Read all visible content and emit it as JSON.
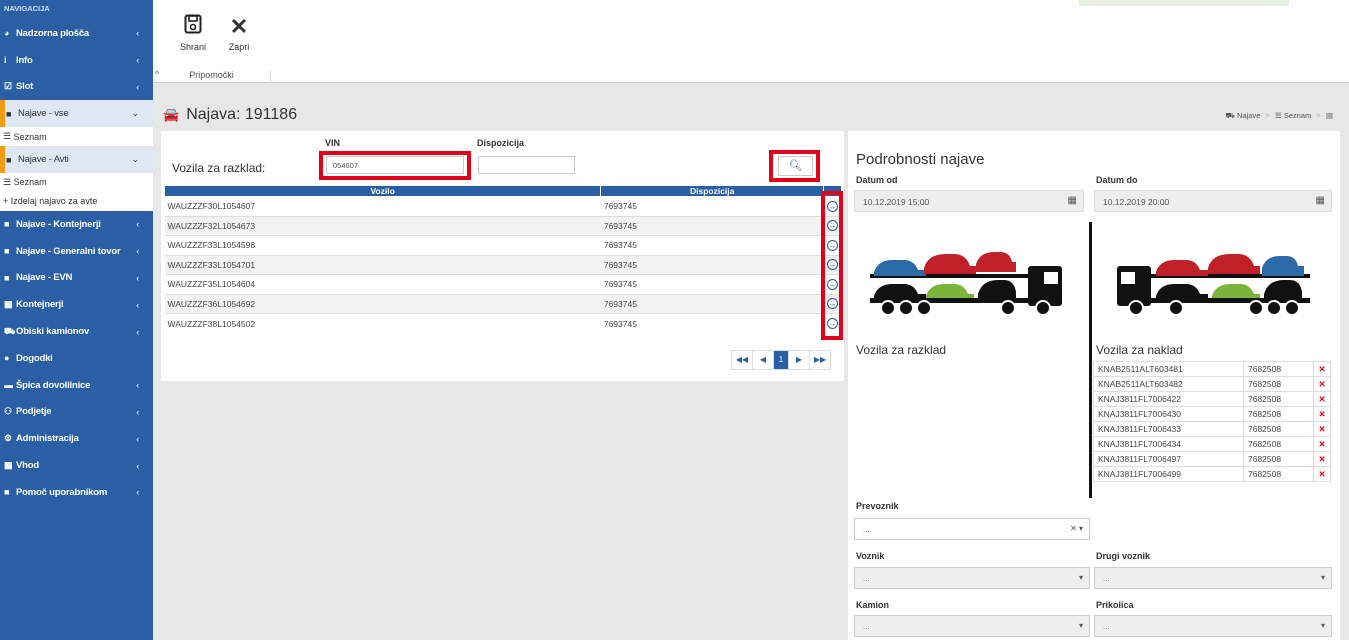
{
  "sidebar": {
    "header": "NAVIGACIJA",
    "items": [
      {
        "icon": "dashboard-icon",
        "label": "Nadzorna plošča"
      },
      {
        "icon": "info-icon",
        "label": "Info"
      },
      {
        "icon": "calendar-check-icon",
        "label": "Slot"
      }
    ],
    "najave_vse": "Najave - vse",
    "najave_vse_sub": "Seznam",
    "najave_avti": "Najave - Avti",
    "najave_avti_sub1": "Seznam",
    "najave_avti_sub2": "Izdelaj najavo za avte",
    "items2": [
      {
        "label": "Najave - Kontejnerji"
      },
      {
        "label": "Najave - Generalni tovor"
      },
      {
        "label": "Najave - EVN"
      },
      {
        "label": "Kontejnerji"
      },
      {
        "label": "Obiski kamionov"
      },
      {
        "label": "Dogodki"
      },
      {
        "label": "Špica dovolilnice"
      },
      {
        "label": "Podjetje"
      },
      {
        "label": "Administracija"
      },
      {
        "label": "Vhod"
      },
      {
        "label": "Pomoč uporabnikom"
      }
    ]
  },
  "toolbar": {
    "save_label": "Shrani",
    "close_label": "Zapri",
    "group_label": "Pripomočki"
  },
  "page": {
    "title": "Najava: 191186"
  },
  "breadcrumb": {
    "item1": "Najave",
    "item2": "Seznam"
  },
  "left": {
    "vin_label": "VIN",
    "dispo_label": "Dispozicija",
    "row_label": "Vozila za razklad:",
    "vin_value": "054607",
    "dispo_value": "",
    "col_vozilo": "Vozilo",
    "col_dispozicija": "Dispozicija",
    "rows": [
      {
        "vin": "WAUZZZF30L1054607",
        "dispo": "7693745"
      },
      {
        "vin": "WAUZZZF32L1054673",
        "dispo": "7693745"
      },
      {
        "vin": "WAUZZZF33L1054598",
        "dispo": "7693745"
      },
      {
        "vin": "WAUZZZF33L1054701",
        "dispo": "7693745"
      },
      {
        "vin": "WAUZZZF35L1054604",
        "dispo": "7693745"
      },
      {
        "vin": "WAUZZZF36L1054692",
        "dispo": "7693745"
      },
      {
        "vin": "WAUZZZF38L1054502",
        "dispo": "7693745"
      }
    ],
    "page": "1"
  },
  "right": {
    "title": "Podrobnosti najave",
    "datum_od_label": "Datum od",
    "datum_od": "10.12.2019 15:00",
    "datum_do_label": "Datum do",
    "datum_do": "10.12.2019 20:00",
    "razklad_label": "Vozila za razklad",
    "naklad_label": "Vozila za naklad",
    "naklad": [
      {
        "vin": "KNAB2511ALT603481",
        "dispo": "7682508"
      },
      {
        "vin": "KNAB2511ALT603482",
        "dispo": "7682508"
      },
      {
        "vin": "KNAJ3811FL7006422",
        "dispo": "7682508"
      },
      {
        "vin": "KNAJ3811FL7006430",
        "dispo": "7682508"
      },
      {
        "vin": "KNAJ3811FL7006433",
        "dispo": "7682508"
      },
      {
        "vin": "KNAJ3811FL7006434",
        "dispo": "7682508"
      },
      {
        "vin": "KNAJ3811FL7006497",
        "dispo": "7682508"
      },
      {
        "vin": "KNAJ3811FL7006499",
        "dispo": "7682508"
      }
    ],
    "prevoznik_label": "Prevoznik",
    "prevoznik_value": "...",
    "voznik_label": "Voznik",
    "voznik_value": "...",
    "drugi_voznik_label": "Drugi voznik",
    "drugi_voznik_value": "...",
    "kamion_label": "Kamion",
    "kamion_value": "...",
    "prikolica_label": "Prikolica",
    "prikolica_value": "..."
  },
  "colors": {
    "sidebar": "#2a5fa5",
    "accent": "#f39c12",
    "highlight": "#e3001b"
  }
}
